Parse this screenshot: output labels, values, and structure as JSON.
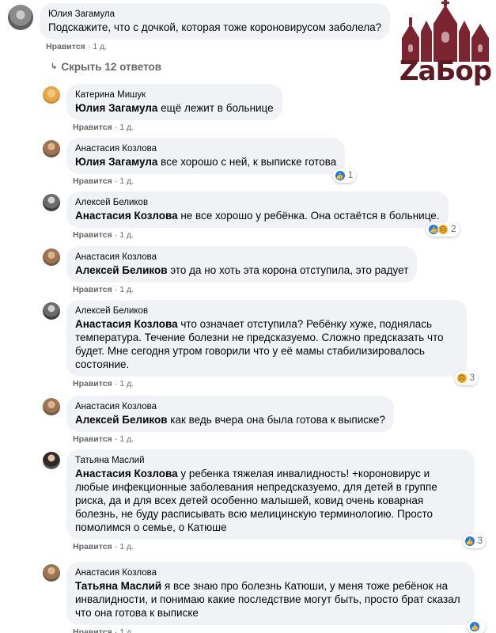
{
  "logo": {
    "text": "ZaБop"
  },
  "reply_toggle": {
    "label": "Скрыть 12 ответов"
  },
  "actions": {
    "like": "Нравится",
    "reply_time": "1 д."
  },
  "colors": {
    "bubble": "#f0f2f5",
    "like_blue": "#1877f2",
    "sad_yellow": "#f7b125",
    "logo_red": "#5d1a22"
  },
  "comments": [
    {
      "author": "Юлия Загамула",
      "mention": "",
      "text": "Подскажите, что с дочкой, которая тоже короновирусом заболела?",
      "reactions": null
    },
    {
      "author": "Катерина Мишук",
      "mention": "Юлия Загамула",
      "text": " ещё лежит в больнице",
      "reactions": null
    },
    {
      "author": "Анастасия Козлова",
      "mention": "Юлия Загамула",
      "text": " все хорошо с ней, к выписке готова",
      "reactions": {
        "icons": [
          "like-icon"
        ],
        "count": "1"
      }
    },
    {
      "author": "Алексей Беликов",
      "mention": "Анастасия Козлова",
      "text": " не все хорошо у ребёнка. Она остаётся в больнице.",
      "reactions": {
        "icons": [
          "like-icon",
          "sad-icon"
        ],
        "count": "2"
      }
    },
    {
      "author": "Анастасия Козлова",
      "mention": "Алексей Беликов",
      "text": " это да но хоть эта корона отступила, это радует",
      "reactions": null
    },
    {
      "author": "Алексей Беликов",
      "mention": "Анастасия Козлова",
      "text": " что означает отступила? Ребёнку хуже, поднялась температура. Течение болезни не предсказуемо. Сложно предсказать что будет. Мне сегодня утром говорили что у её мамы стабилизировалось состояние.",
      "reactions": {
        "icons": [
          "sad-icon"
        ],
        "count": "3"
      }
    },
    {
      "author": "Анастасия Козлова",
      "mention": "Алексей Беликов",
      "text": " как ведь вчера она была готова к выписке?",
      "reactions": null
    },
    {
      "author": "Татьяна Маслий",
      "mention": "Анастасия Козлова",
      "text": " у ребенка тяжелая инвалидность! +короновирус и любые инфекционные заболевания непредсказуемо, для детей в группе риска, да и для всех детей особенно малышей, ковид очень коварная болезнь, не буду расписывать всю мелицинскую терминологию. Просто помолимся о семье, о Катюше",
      "reactions": {
        "icons": [
          "like-icon"
        ],
        "count": "3"
      }
    },
    {
      "author": "Анастасия Козлова",
      "mention": "Татьяна Маслий",
      "text": " я все знаю про болезнь Катюши, у меня тоже ребёнок на инвалидности, и понимаю какие последствие могут быть, просто брат сказал что она готова к выписке",
      "reactions": {
        "icons": [
          "like-icon"
        ],
        "count": ""
      }
    }
  ]
}
